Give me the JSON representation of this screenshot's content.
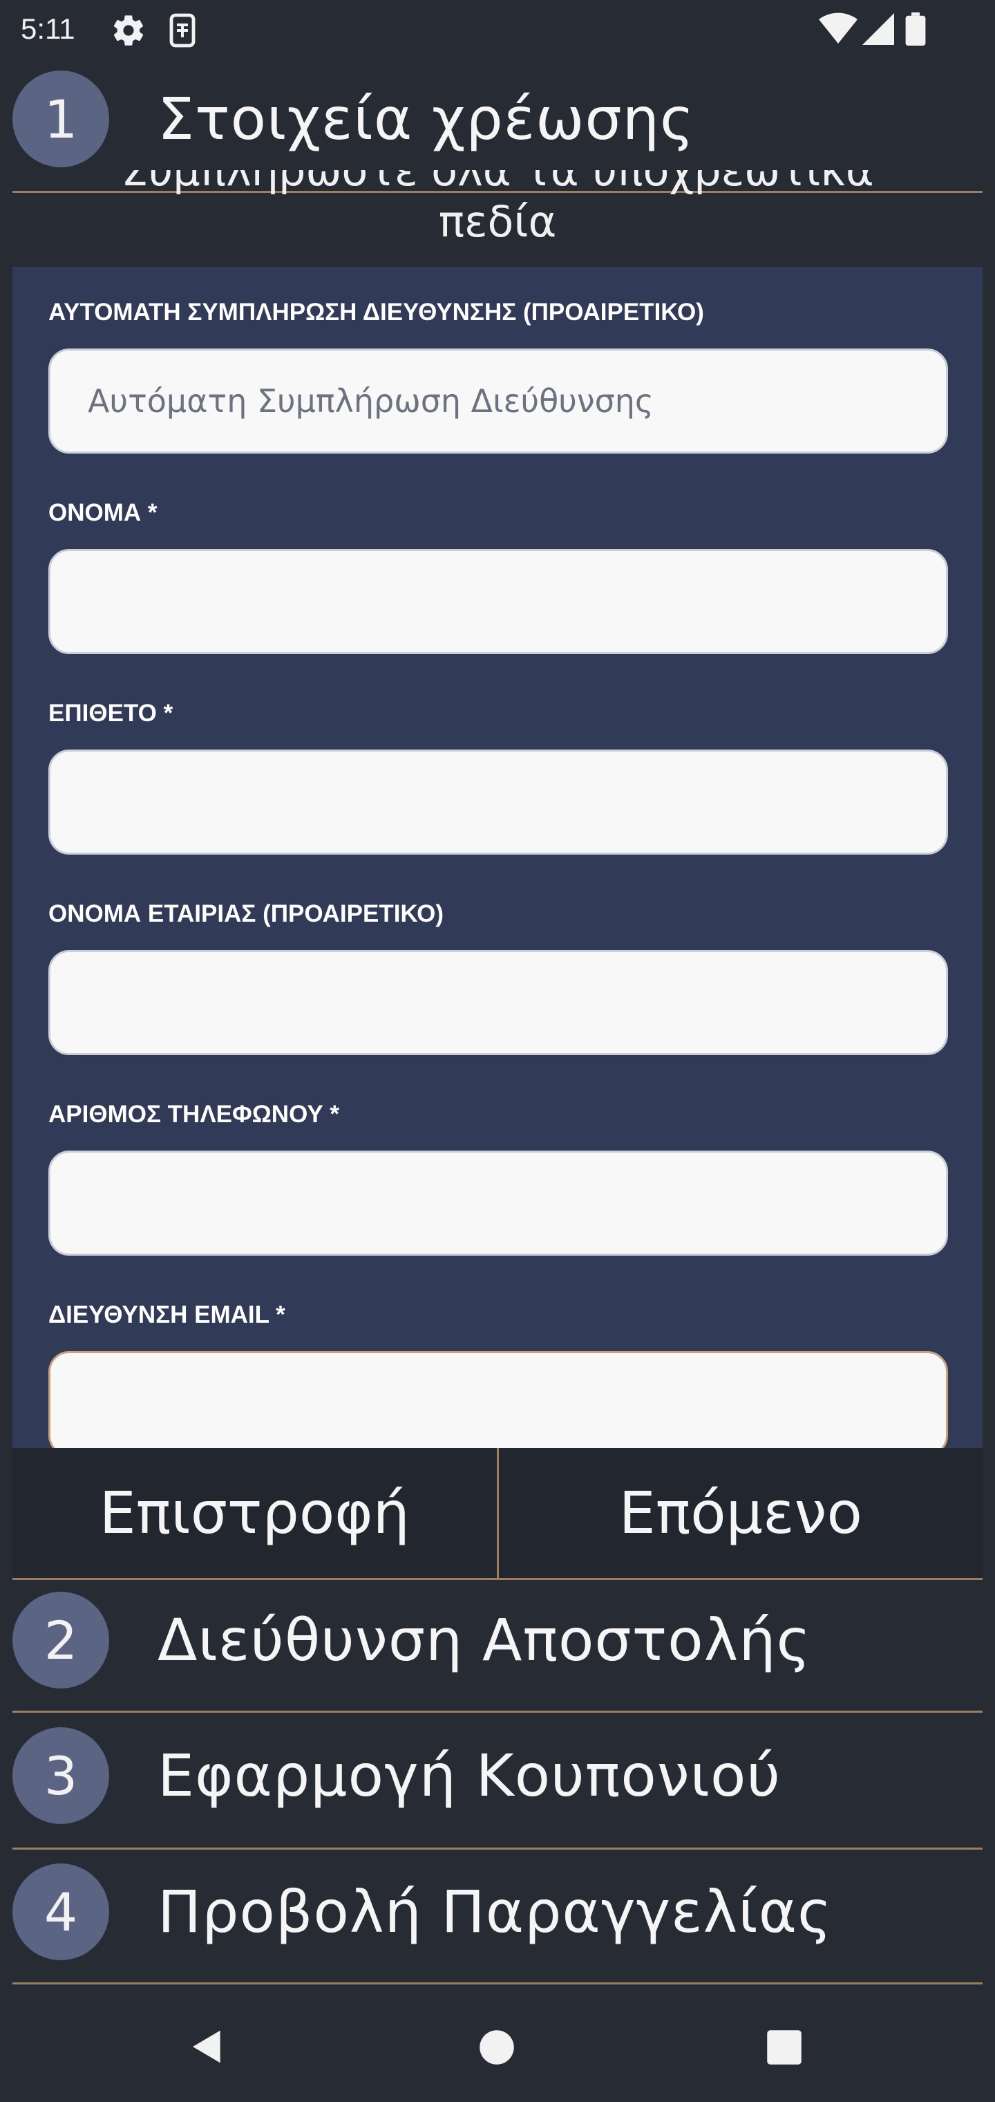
{
  "status_bar": {
    "time": "5:11",
    "icons": [
      "gear-icon",
      "sim-icon",
      "wifi-icon",
      "signal-icon",
      "battery-icon"
    ]
  },
  "steps": [
    {
      "number": "1",
      "title": "Στοιχεία χρέωσης"
    },
    {
      "number": "2",
      "title": "Διεύθυνση Αποστολής"
    },
    {
      "number": "3",
      "title": "Εφαρμογή Κουπονιού"
    },
    {
      "number": "4",
      "title": "Προβολή Παραγγελίας"
    }
  ],
  "hint": {
    "line1": "Συμπληρώστε όλα τα υποχρεωτικά",
    "line2": "πεδία"
  },
  "form": {
    "fields": [
      {
        "label": "ΑΥΤΟΜΑΤΗ ΣΥΜΠΛΗΡΩΣΗ ΔΙΕΥΘΥΝΣΗΣ (ΠΡΟΑΙΡΕΤΙΚΟ)",
        "value": "",
        "placeholder": "Αυτόματη Συμπλήρωση Διεύθυνσης"
      },
      {
        "label": "ΟΝΟΜΑ *",
        "value": "",
        "placeholder": ""
      },
      {
        "label": "ΕΠΙΘΕΤΟ *",
        "value": "",
        "placeholder": ""
      },
      {
        "label": "ΟΝΟΜΑ ΕΤΑΙΡΙΑΣ (ΠΡΟΑΙΡΕΤΙΚΟ)",
        "value": "",
        "placeholder": ""
      },
      {
        "label": "ΑΡΙΘΜΟΣ ΤΗΛΕΦΩΝΟΥ *",
        "value": "",
        "placeholder": ""
      },
      {
        "label": "ΔΙΕΥΘΥΝΣΗ EMAIL *",
        "value": "",
        "placeholder": ""
      }
    ]
  },
  "buttons": {
    "back": "Επιστροφή",
    "next": "Επόμενο"
  },
  "colors": {
    "background": "#272b33",
    "panel": "#313a56",
    "accent": "#9c7f5d",
    "step_circle": "#5b6583"
  }
}
